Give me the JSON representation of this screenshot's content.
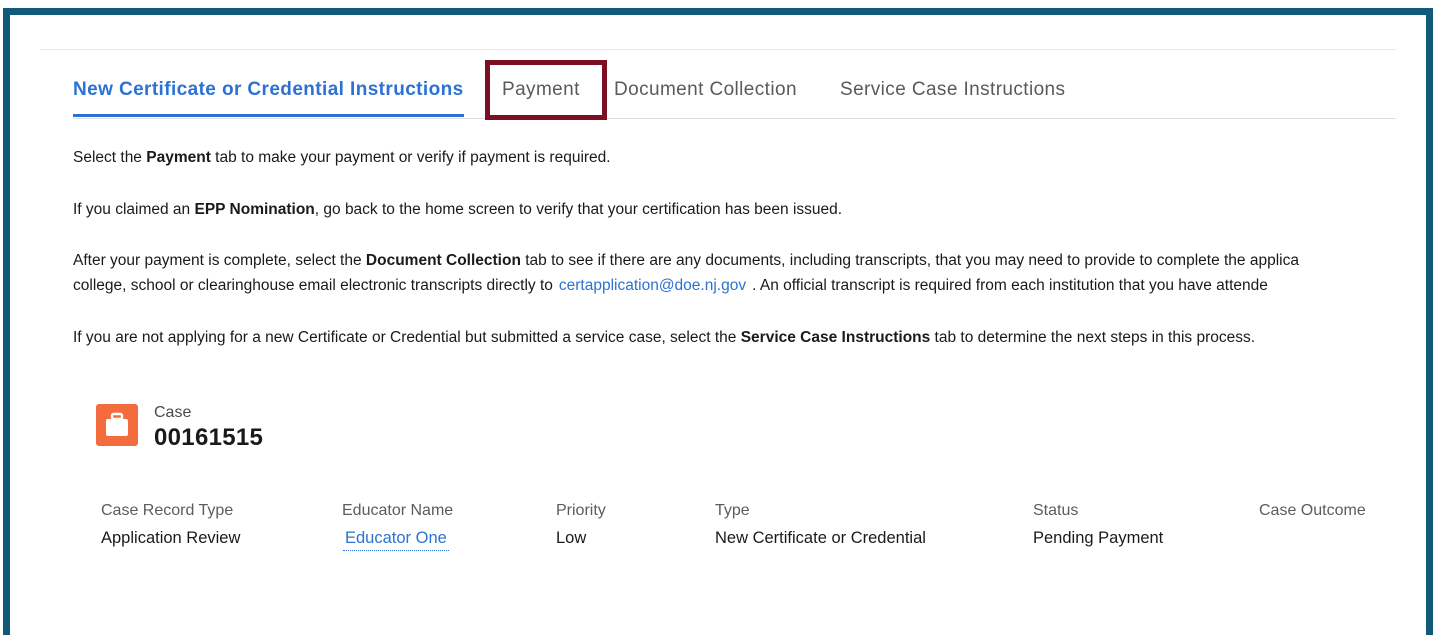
{
  "tabs": [
    {
      "label": "New Certificate or Credential Instructions",
      "active": true
    },
    {
      "label": "Payment",
      "active": false,
      "highlighted": true
    },
    {
      "label": "Document Collection",
      "active": false
    },
    {
      "label": "Service Case Instructions",
      "active": false
    }
  ],
  "instructions": {
    "p1": {
      "pre": "Select the ",
      "bold": "Payment",
      "post": " tab to make your payment or verify if payment is required."
    },
    "p2": {
      "pre": "If you claimed an ",
      "bold": "EPP Nomination",
      "post": ", go back to the home screen to verify that your certification has been issued."
    },
    "p3": {
      "line1_pre": "After your payment is complete, select the ",
      "line1_bold": "Document Collection",
      "line1_post": " tab to see if there are any documents, including transcripts, that you may need to provide to complete the applica",
      "line2_pre": "college, school or clearinghouse email electronic transcripts directly to",
      "email": "certapplication@doe.nj.gov",
      "line2_post": ". An official transcript is required from each institution that you have attende"
    },
    "p4": {
      "pre": "If you are not applying for a new Certificate or Credential but submitted a service case, select the ",
      "bold": "Service Case Instructions",
      "post": " tab to determine the next steps in this process."
    }
  },
  "case": {
    "icon": "briefcase-icon",
    "icon_color": "#f36c3d",
    "label": "Case",
    "number": "00161515"
  },
  "fields": [
    {
      "label": "Case Record Type",
      "value": "Application Review"
    },
    {
      "label": "Educator Name",
      "value": "Educator One",
      "link": true
    },
    {
      "label": "Priority",
      "value": "Low"
    },
    {
      "label": "Type",
      "value": "New Certificate or Credential"
    },
    {
      "label": "Status",
      "value": "Pending Payment"
    },
    {
      "label": "Case Outcome",
      "value": ""
    }
  ],
  "colors": {
    "frame": "#12597a",
    "accent": "#2d72d2",
    "highlight_box": "#7b1024"
  }
}
